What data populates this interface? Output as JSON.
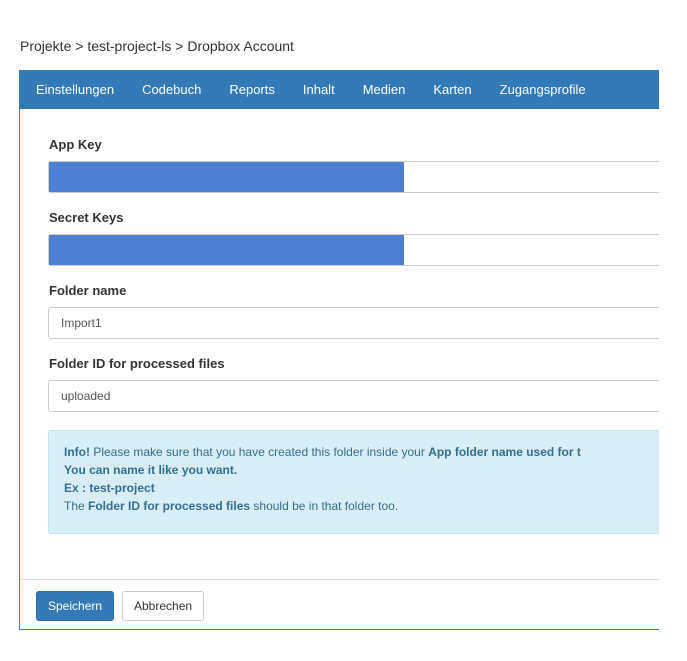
{
  "breadcrumb": {
    "root": "Projekte",
    "sep1": " > ",
    "project": "test-project-ls",
    "sep2": " > ",
    "current": "Dropbox Account"
  },
  "tabs": [
    {
      "label": "Einstellungen"
    },
    {
      "label": "Codebuch"
    },
    {
      "label": "Reports"
    },
    {
      "label": "Inhalt"
    },
    {
      "label": "Medien"
    },
    {
      "label": "Karten"
    },
    {
      "label": "Zugangsprofile"
    }
  ],
  "form": {
    "app_key_label": "App Key",
    "secret_keys_label": "Secret Keys",
    "folder_name_label": "Folder name",
    "folder_name_value": "Import1",
    "folder_id_label": "Folder ID for processed files",
    "folder_id_value": "uploaded"
  },
  "info": {
    "title": "Info!",
    "line1_text": " Please make sure that you have created this folder inside your ",
    "line1_bold": "App folder name used for t",
    "line2": "You can name it like you want.",
    "line3": "Ex : test-project",
    "line4_pre": "The ",
    "line4_bold": "Folder ID for processed files",
    "line4_post": " should be in that folder too."
  },
  "buttons": {
    "save": "Speichern",
    "cancel": "Abbrechen"
  },
  "colors": {
    "primary": "#337ab7",
    "redaction": "#4f7fd1",
    "info_bg": "#d9edf7",
    "info_text": "#31708f"
  }
}
